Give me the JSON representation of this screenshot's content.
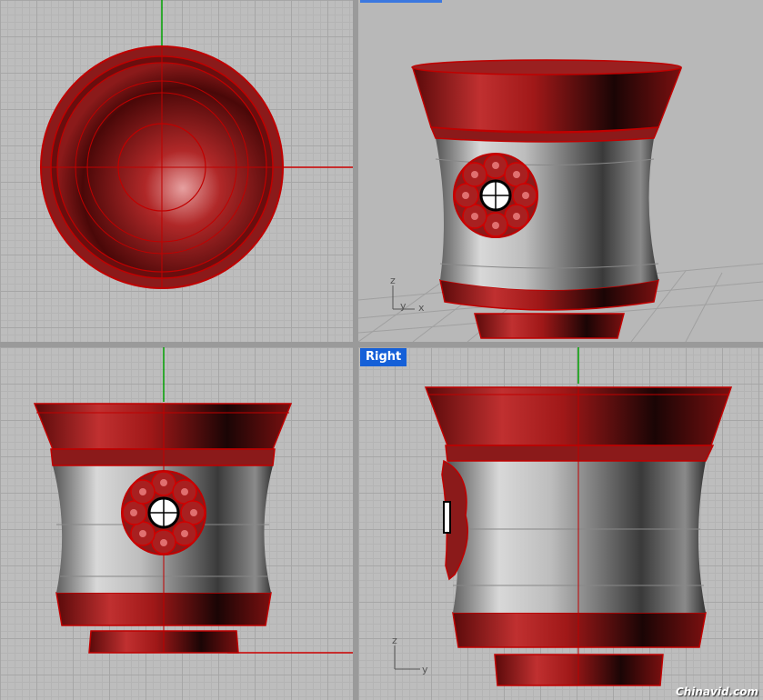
{
  "viewports": {
    "top": {
      "title": ""
    },
    "perspective": {
      "title": ""
    },
    "front": {
      "title": ""
    },
    "right": {
      "title": "Right"
    }
  },
  "axes": {
    "x": "x",
    "y": "y",
    "z": "z"
  },
  "watermark": "Chinavid.com",
  "colors": {
    "viewport_bg": "#bdbdbd",
    "grid_major": "#a6a6a6",
    "model_red": "#8b1a1a",
    "edge_red": "#c00000",
    "title_blue": "#1560d8",
    "x_axis": "#cc0000",
    "y_axis": "#00a000"
  }
}
